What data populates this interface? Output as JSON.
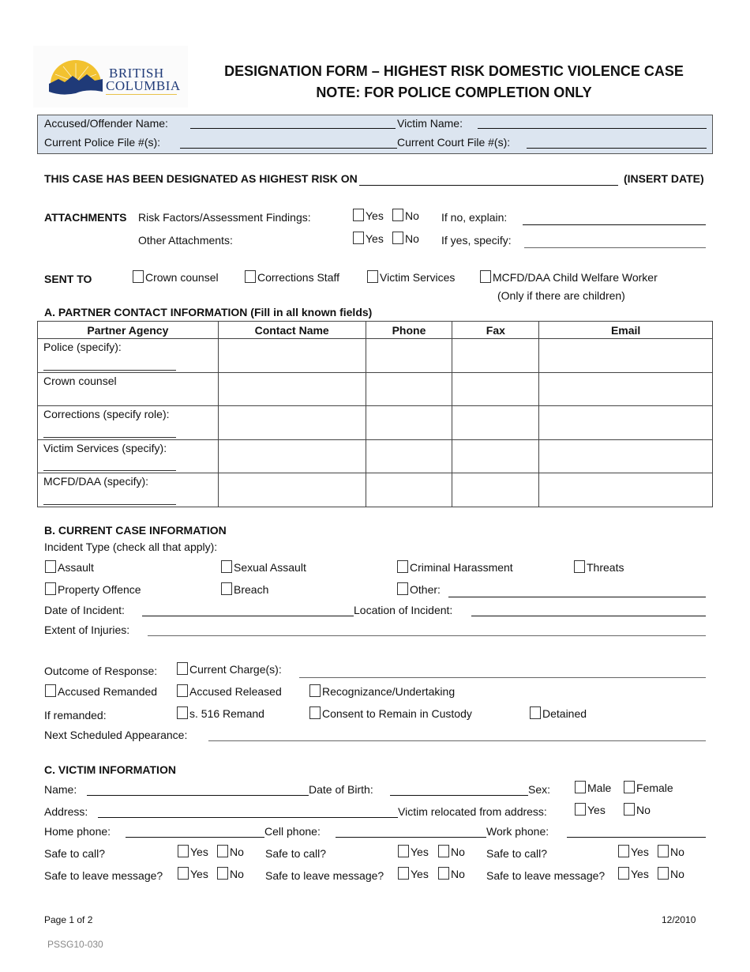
{
  "header": {
    "logo": {
      "line1": "BRITISH",
      "line2": "COLUMBIA",
      "icon": "bc-sun-mountains-logo",
      "colors": {
        "sun": "#f2c230",
        "mountains": "#1f3a78"
      }
    },
    "title_line1": "DESIGNATION FORM – HIGHEST RISK DOMESTIC VIOLENCE CASE",
    "title_line2": "NOTE: FOR POLICE COMPLETION ONLY"
  },
  "id_box": {
    "bg_color": "#dce5f0",
    "accused_label": "Accused/Offender Name:",
    "accused_value": "",
    "victim_label": "Victim Name:",
    "victim_value": "",
    "police_file_label": "Current Police File #(s):",
    "police_file_value": "",
    "court_file_label": "Current Court File #(s):",
    "court_file_value": ""
  },
  "designation": {
    "label": "THIS CASE HAS BEEN DESIGNATED AS HIGHEST RISK ON",
    "value": "",
    "suffix": "(INSERT DATE)"
  },
  "attachments": {
    "heading": "ATTACHMENTS",
    "rows": [
      {
        "label": "Risk Factors/Assessment Findings:",
        "yes": "Yes",
        "no": "No",
        "followup_label": "If no, explain:",
        "followup_value": ""
      },
      {
        "label": "Other Attachments:",
        "yes": "Yes",
        "no": "No",
        "followup_label": "If yes, specify:",
        "followup_value": ""
      }
    ]
  },
  "sent_to": {
    "heading": "SENT TO",
    "options": [
      "Crown counsel",
      "Corrections Staff",
      "Victim Services",
      "MCFD/DAA Child Welfare Worker"
    ],
    "note": "(Only if there are children)"
  },
  "section_a": {
    "heading": "A.  PARTNER CONTACT INFORMATION (Fill in all known fields)",
    "columns": [
      "Partner Agency",
      "Contact Name",
      "Phone",
      "Fax",
      "Email"
    ],
    "rows": [
      {
        "agency": "Police (specify):",
        "has_line": true
      },
      {
        "agency": "Crown counsel",
        "has_line": false
      },
      {
        "agency": "Corrections (specify role):",
        "has_line": true
      },
      {
        "agency": "Victim Services (specify):",
        "has_line": true
      },
      {
        "agency": "MCFD/DAA (specify):",
        "has_line": true
      }
    ]
  },
  "section_b": {
    "heading": "B.  CURRENT CASE INFORMATION",
    "incident_type_label": "Incident Type (check all that apply):",
    "incident_types": [
      "Assault",
      "Sexual Assault",
      "Criminal Harassment",
      "Threats",
      "Property Offence",
      "Breach",
      "Other:"
    ],
    "other_value": "",
    "date_label": "Date of Incident:",
    "date_value": "",
    "location_label": "Location of Incident:",
    "location_value": "",
    "injuries_label": "Extent of Injuries:",
    "injuries_value": "",
    "outcome_label": "Outcome of Response:",
    "current_charges_label": "Current Charge(s):",
    "current_charges_value": "",
    "outcome_options": [
      "Accused Remanded",
      "Accused Released",
      "Recognizance/Undertaking"
    ],
    "remanded_label": "If remanded:",
    "remanded_options": [
      "s. 516 Remand",
      "Consent to Remain in Custody",
      "Detained"
    ],
    "next_appearance_label": "Next Scheduled Appearance:",
    "next_appearance_value": ""
  },
  "section_c": {
    "heading": "C.  VICTIM INFORMATION",
    "name_label": "Name:",
    "name_value": "",
    "dob_label": "Date of Birth:",
    "dob_value": "",
    "sex_label": "Sex:",
    "sex_options": [
      "Male",
      "Female"
    ],
    "address_label": "Address:",
    "address_value": "",
    "relocated_label": "Victim relocated from address:",
    "relocated_options": [
      "Yes",
      "No"
    ],
    "phones": [
      {
        "label": "Home phone:",
        "value": ""
      },
      {
        "label": "Cell phone:",
        "value": ""
      },
      {
        "label": "Work phone:",
        "value": ""
      }
    ],
    "safe_to_call_label": "Safe to call?",
    "safe_to_leave_label": "Safe to leave message?",
    "yes": "Yes",
    "no": "No"
  },
  "footer": {
    "page": "Page 1 of 2",
    "date": "12/2010",
    "code": "PSSG10-030"
  }
}
